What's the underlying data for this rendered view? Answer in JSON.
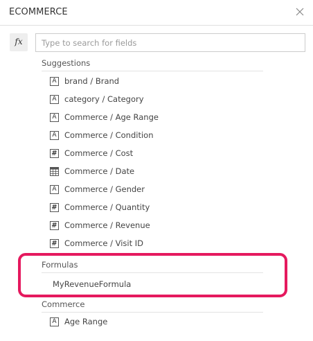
{
  "header": {
    "title": "ECOMMERCE",
    "close_icon": "close-icon"
  },
  "search": {
    "fx_label": "fx",
    "placeholder": "Type to search for fields",
    "value": ""
  },
  "suggestions": {
    "label": "Suggestions",
    "items": [
      {
        "icon": "text-type-icon",
        "type_glyph": "A",
        "label": "brand / Brand"
      },
      {
        "icon": "text-type-icon",
        "type_glyph": "A",
        "label": "category / Category"
      },
      {
        "icon": "text-type-icon",
        "type_glyph": "A",
        "label": "Commerce / Age Range"
      },
      {
        "icon": "text-type-icon",
        "type_glyph": "A",
        "label": "Commerce / Condition"
      },
      {
        "icon": "number-type-icon",
        "type_glyph": "#",
        "label": "Commerce / Cost"
      },
      {
        "icon": "date-type-icon",
        "type_glyph": "",
        "label": "Commerce / Date"
      },
      {
        "icon": "text-type-icon",
        "type_glyph": "A",
        "label": "Commerce / Gender"
      },
      {
        "icon": "number-type-icon",
        "type_glyph": "#",
        "label": "Commerce / Quantity"
      },
      {
        "icon": "number-type-icon",
        "type_glyph": "#",
        "label": "Commerce / Revenue"
      },
      {
        "icon": "number-type-icon",
        "type_glyph": "#",
        "label": "Commerce / Visit ID"
      }
    ]
  },
  "formulas": {
    "label": "Formulas",
    "items": [
      {
        "label": "MyRevenueFormula"
      }
    ]
  },
  "commerce": {
    "label": "Commerce",
    "items": [
      {
        "icon": "text-type-icon",
        "type_glyph": "A",
        "label": "Age Range"
      }
    ]
  },
  "colors": {
    "highlight": "#e5195e",
    "divider": "#e0e0e0",
    "text": "#444444"
  }
}
